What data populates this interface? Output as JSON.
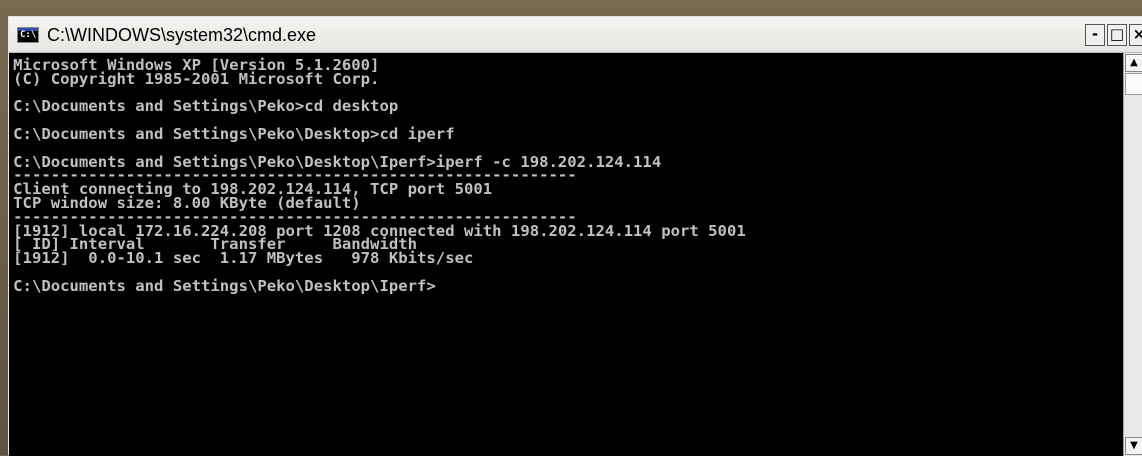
{
  "window": {
    "title": "C:\\WINDOWS\\system32\\cmd.exe",
    "icon": "cmd-console-icon",
    "icon_glyph": "C:\\",
    "buttons": {
      "minimize": "-",
      "maximize": "□",
      "close": "×"
    }
  },
  "console": {
    "lines": [
      "Microsoft Windows XP [Version 5.1.2600]",
      "(C) Copyright 1985-2001 Microsoft Corp.",
      "",
      "C:\\Documents and Settings\\Peko>cd desktop",
      "",
      "C:\\Documents and Settings\\Peko\\Desktop>cd iperf",
      "",
      "C:\\Documents and Settings\\Peko\\Desktop\\Iperf>iperf -c 198.202.124.114",
      "------------------------------------------------------------",
      "Client connecting to 198.202.124.114, TCP port 5001",
      "TCP window size: 8.00 KByte (default)",
      "------------------------------------------------------------",
      "[1912] local 172.16.224.208 port 1208 connected with 198.202.124.114 port 5001",
      "[ ID] Interval       Transfer     Bandwidth",
      "[1912]  0.0-10.1 sec  1.17 MBytes   978 Kbits/sec",
      "",
      "C:\\Documents and Settings\\Peko\\Desktop\\Iperf>"
    ]
  },
  "scrollbar": {
    "up_arrow": "▲",
    "down_arrow": "▼"
  },
  "colors": {
    "console_bg": "#000000",
    "console_fg": "#c0c0c0",
    "desktop_bg": "#6d6147"
  }
}
